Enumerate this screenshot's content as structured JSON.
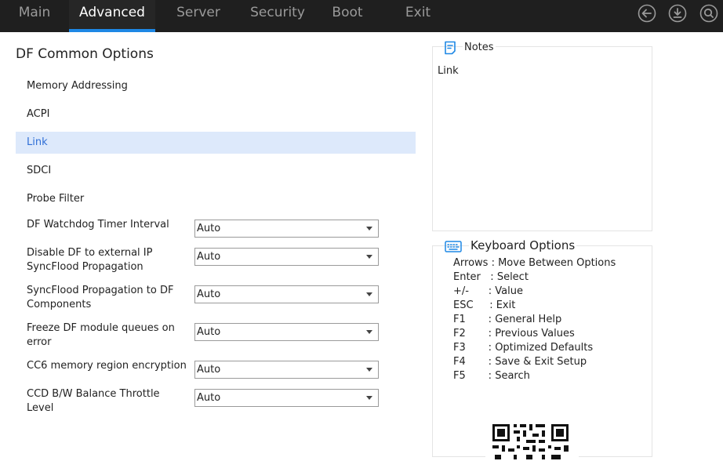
{
  "tabs": [
    {
      "label": "Main"
    },
    {
      "label": "Advanced"
    },
    {
      "label": "Server"
    },
    {
      "label": "Security"
    },
    {
      "label": "Boot"
    },
    {
      "label": "Exit"
    }
  ],
  "toolbar_icons": [
    "back-icon",
    "download-icon",
    "search-icon"
  ],
  "section_title": "DF Common Options",
  "menu_items": [
    {
      "label": "Memory Addressing"
    },
    {
      "label": "ACPI"
    },
    {
      "label": "Link"
    },
    {
      "label": "SDCI"
    },
    {
      "label": "Probe Filter"
    }
  ],
  "options": [
    {
      "label": "DF Watchdog Timer Interval",
      "value": "Auto"
    },
    {
      "label": "Disable DF to external IP SyncFlood Propagation",
      "value": "Auto"
    },
    {
      "label": "SyncFlood Propagation to DF Components",
      "value": "Auto"
    },
    {
      "label": "Freeze DF module queues on error",
      "value": "Auto"
    },
    {
      "label": "CC6 memory region encryption",
      "value": "Auto"
    },
    {
      "label": "CCD B/W Balance Throttle Level",
      "value": "Auto"
    }
  ],
  "notes": {
    "title": "Notes",
    "text": "Link"
  },
  "keyboard": {
    "title": "Keyboard Options",
    "lines": [
      {
        "key": "Arrows",
        "desc": " : Move Between Options"
      },
      {
        "key": "Enter",
        "desc": "   : Select"
      },
      {
        "key": "+/-",
        "desc": "      : Value"
      },
      {
        "key": "ESC",
        "desc": "     : Exit"
      },
      {
        "key": "F1",
        "desc": "       : General Help"
      },
      {
        "key": "F2",
        "desc": "       : Previous Values"
      },
      {
        "key": "F3",
        "desc": "       : Optimized Defaults"
      },
      {
        "key": "F4",
        "desc": "       : Save & Exit Setup"
      },
      {
        "key": "F5",
        "desc": "       : Search"
      }
    ]
  },
  "colors": {
    "topbar": "#1f1f1f",
    "accent": "#1e88e5",
    "selected_bg": "#dde9fb",
    "selected_text": "#2f6fd6"
  }
}
